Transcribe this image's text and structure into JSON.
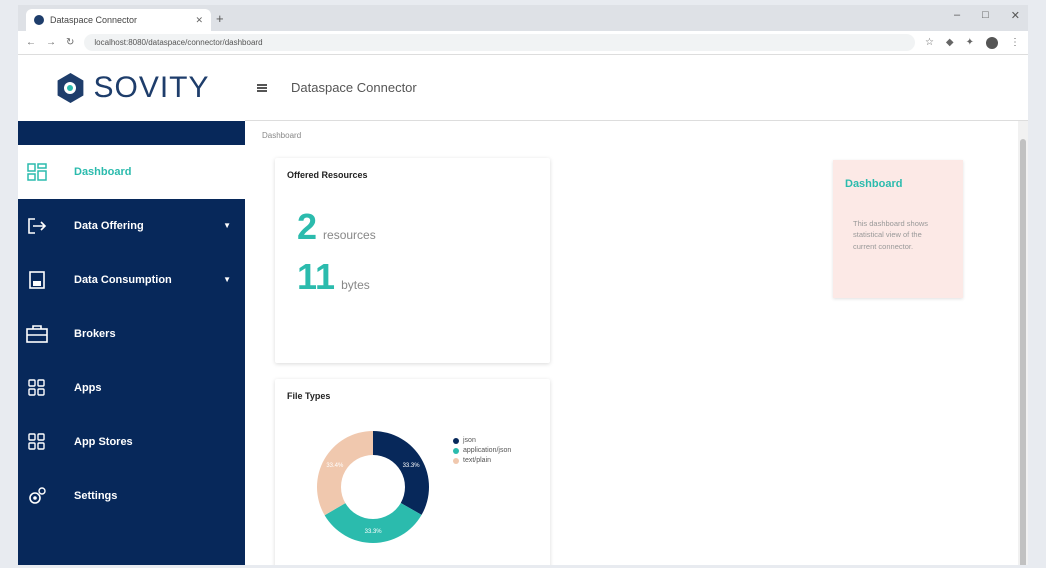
{
  "browser": {
    "tab_title": "Dataspace Connector",
    "url": "localhost:8080/dataspace/connector/dashboard",
    "window_controls": [
      "–",
      "□",
      "✕"
    ]
  },
  "logo": {
    "text": "SOVITY"
  },
  "header": {
    "title": "Dataspace Connector"
  },
  "sidebar": {
    "items": [
      {
        "label": "Dashboard",
        "icon": "dashboard-icon",
        "active": true
      },
      {
        "label": "Data Offering",
        "icon": "export-icon",
        "caret": "▼"
      },
      {
        "label": "Data Consumption",
        "icon": "import-icon",
        "caret": "▼"
      },
      {
        "label": "Brokers",
        "icon": "broker-icon"
      },
      {
        "label": "Apps",
        "icon": "apps-icon"
      },
      {
        "label": "App Stores",
        "icon": "app-stores-icon"
      },
      {
        "label": "Settings",
        "icon": "settings-icon"
      }
    ]
  },
  "breadcrumb": "Dashboard",
  "offered_resources": {
    "title": "Offered Resources",
    "resources_count": "2",
    "resources_unit": "resources",
    "size_value": "11",
    "size_unit": "bytes"
  },
  "file_types": {
    "title": "File Types",
    "legend": [
      "json",
      "application/json",
      "text/plain"
    ]
  },
  "info_card": {
    "title": "Dashboard",
    "body": "This dashboard shows statistical view of the current connector."
  },
  "chart_data": {
    "type": "pie",
    "title": "File Types",
    "donut": true,
    "slices": [
      {
        "label": "json",
        "value": 33.3,
        "color": "#07285a"
      },
      {
        "label": "application/json",
        "value": 33.3,
        "color": "#2bbbad"
      },
      {
        "label": "text/plain",
        "value": 33.4,
        "color": "#f0c8ae"
      }
    ],
    "data_labels": [
      "33.3%",
      "33.3%",
      "33.4%"
    ],
    "legend_position": "right"
  },
  "colors": {
    "sidebar": "#07285a",
    "accent": "#2bbbad",
    "info_bg": "#fce9e6"
  }
}
